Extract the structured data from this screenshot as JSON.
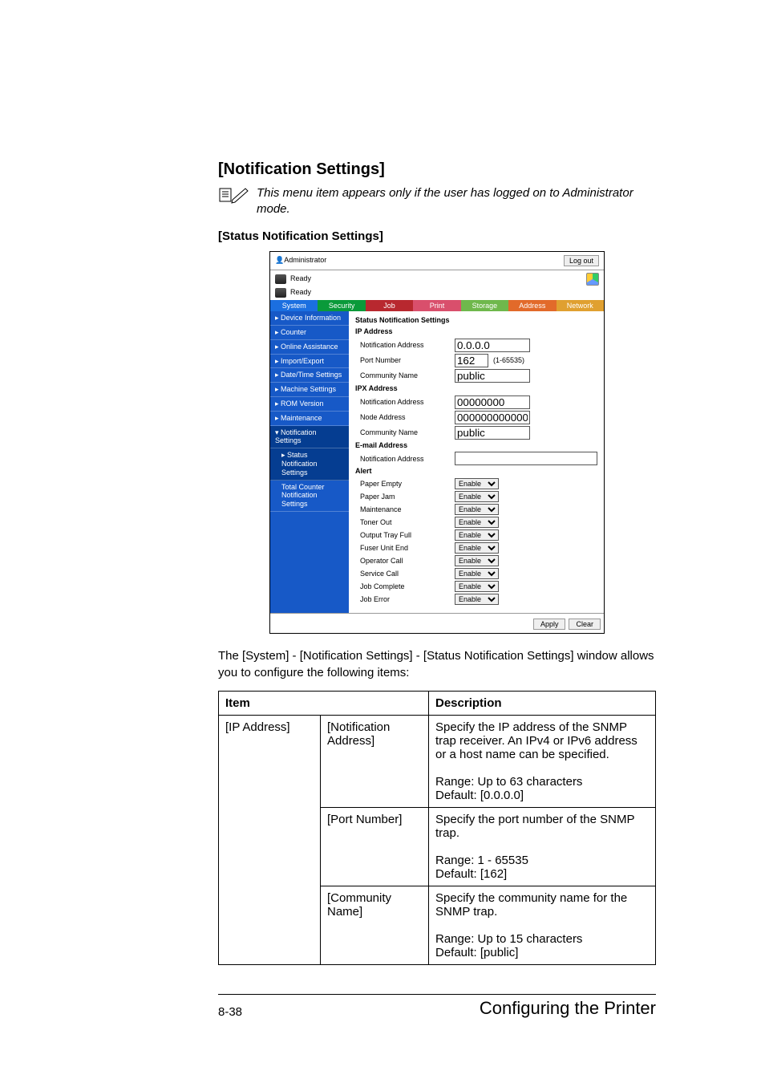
{
  "heading": "[Notification Settings]",
  "note_icon_alt": "note-pencil-icon",
  "note": "This menu item appears only if the user has logged on to Administrator mode.",
  "subheading": "[Status Notification Settings]",
  "screenshot": {
    "admin_label": "Administrator",
    "logout": "Log out",
    "ready1": "Ready",
    "ready2": "Ready",
    "tabs": {
      "system": "System",
      "security": "Security",
      "job": "Job",
      "print": "Print",
      "storage": "Storage",
      "address": "Address",
      "network": "Network"
    },
    "sidebar": {
      "dev": "▸ Device Information",
      "counter": "▸ Counter",
      "online": "▸ Online Assistance",
      "import": "▸ Import/Export",
      "date": "▸ Date/Time Settings",
      "machine": "▸ Machine Settings",
      "rom": "▸ ROM Version",
      "maint": "▸ Maintenance",
      "notif": "▾ Notification Settings",
      "status": "▸ Status Notification Settings",
      "total": "  Total Counter Notification Settings"
    },
    "pane": {
      "title": "Status Notification Settings",
      "ipaddr_h": "IP Address",
      "notif_addr": "Notification Address",
      "notif_addr_val": "0.0.0.0",
      "port": "Port Number",
      "port_val": "162",
      "port_suffix": "(1-65535)",
      "comm": "Community Name",
      "comm_val": "public",
      "ipx_h": "IPX Address",
      "ipx_notif": "Notification Address",
      "ipx_notif_val": "00000000",
      "node": "Node Address",
      "node_val": "000000000000",
      "ipx_comm": "Community Name",
      "ipx_comm_val": "public",
      "email_h": "E-mail Address",
      "email_notif": "Notification Address",
      "email_val": "",
      "alert_h": "Alert",
      "alerts": [
        "Paper Empty",
        "Paper Jam",
        "Maintenance",
        "Toner Out",
        "Output Tray Full",
        "Fuser Unit End",
        "Operator Call",
        "Service Call",
        "Job Complete",
        "Job Error"
      ],
      "enable": "Enable",
      "apply": "Apply",
      "clear": "Clear"
    }
  },
  "paragraph": "The [System] - [Notification Settings] - [Status Notification Settings] window allows you to configure the following items:",
  "table": {
    "h1": "Item",
    "h2": "Description",
    "r1c1": "[IP Address]",
    "r1c2": "[Notification Address]",
    "r1c3": "Specify the IP address of the SNMP trap receiver. An IPv4 or IPv6 address or a host name can be specified.",
    "r1c3b": "Range: Up to 63 characters\nDefault: [0.0.0.0]",
    "r2c2": "[Port Number]",
    "r2c3": "Specify the port number of the SNMP trap.",
    "r2c3b": "Range: 1 - 65535\nDefault: [162]",
    "r3c2": "[Community Name]",
    "r3c3": "Specify the community name for the SNMP trap.",
    "r3c3b": "Range: Up to 15 characters\nDefault: [public]"
  },
  "footer": {
    "page": "8-38",
    "title": "Configuring the Printer"
  }
}
